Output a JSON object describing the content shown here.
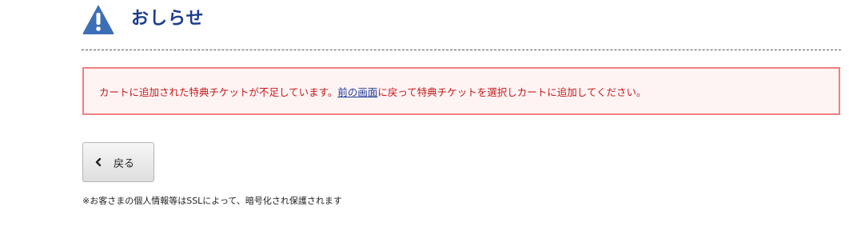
{
  "header": {
    "icon": "warning-icon",
    "icon_color": "#3d6fb6",
    "title": "おしらせ"
  },
  "notice": {
    "message_before": "カートに追加された特典チケットが不足しています。",
    "link_text": "前の画面",
    "message_after": "に戻って特典チケットを選択しカートに追加してください。",
    "text_color": "#c41a1a",
    "border_color": "#f07f7f",
    "background_color": "#fff4f4"
  },
  "back_button": {
    "icon": "chevron-left-icon",
    "label": "戻る"
  },
  "footer": {
    "ssl_note": "※お客さまの個人情報等はSSLによって、暗号化され保護されます"
  }
}
